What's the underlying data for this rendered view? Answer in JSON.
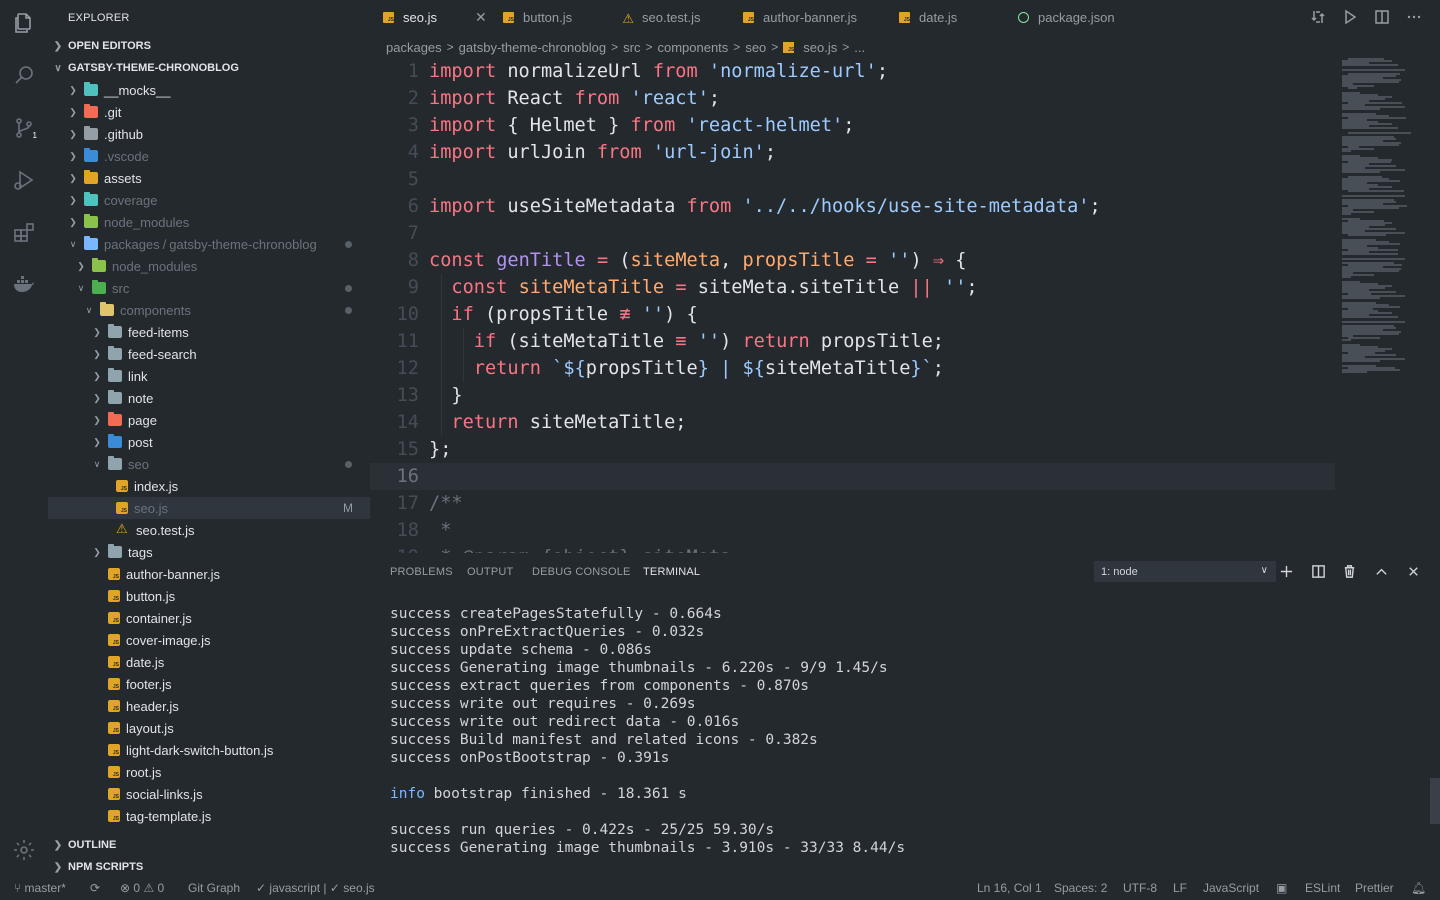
{
  "activity": {
    "icons": [
      "files-icon",
      "search-icon",
      "source-control-icon",
      "run-debug-icon",
      "extensions-icon",
      "docker-icon",
      "settings-gear-icon"
    ],
    "source_control_badge": "1"
  },
  "sidebar": {
    "title": "EXPLORER",
    "open_editors": "OPEN EDITORS",
    "project": "GATSBY-THEME-CHRONOBLOG",
    "tree": [
      {
        "label": "__mocks__",
        "dim": false
      },
      {
        "label": ".git",
        "dim": false
      },
      {
        "label": ".github",
        "dim": false
      },
      {
        "label": ".vscode",
        "dim": true
      },
      {
        "label": "assets",
        "dim": false
      },
      {
        "label": "coverage",
        "dim": true
      },
      {
        "label": "node_modules",
        "dim": true
      },
      {
        "label": "packages",
        "label2": "gatsby-theme-chronoblog",
        "sep": "/",
        "dim": true
      },
      {
        "label": "node_modules",
        "dim": true
      },
      {
        "label": "src",
        "dim": true
      },
      {
        "label": "components",
        "dim": true
      },
      {
        "label": "feed-items",
        "dim": false
      },
      {
        "label": "feed-search",
        "dim": false
      },
      {
        "label": "link",
        "dim": false
      },
      {
        "label": "note",
        "dim": false
      },
      {
        "label": "page",
        "dim": false
      },
      {
        "label": "post",
        "dim": false
      },
      {
        "label": "seo",
        "dim": true
      },
      {
        "label": "index.js",
        "dim": false
      },
      {
        "label": "seo.js",
        "dim": true,
        "badge": "M"
      },
      {
        "label": "seo.test.js",
        "dim": false
      },
      {
        "label": "tags",
        "dim": false
      },
      {
        "label": "author-banner.js",
        "dim": false
      },
      {
        "label": "button.js",
        "dim": false
      },
      {
        "label": "container.js",
        "dim": false
      },
      {
        "label": "cover-image.js",
        "dim": false
      },
      {
        "label": "date.js",
        "dim": false
      },
      {
        "label": "footer.js",
        "dim": false
      },
      {
        "label": "header.js",
        "dim": false
      },
      {
        "label": "layout.js",
        "dim": false
      },
      {
        "label": "light-dark-switch-button.js",
        "dim": false
      },
      {
        "label": "root.js",
        "dim": false
      },
      {
        "label": "social-links.js",
        "dim": false
      },
      {
        "label": "tag-template.js",
        "dim": false
      }
    ],
    "outline": "OUTLINE",
    "npm_scripts": "NPM SCRIPTS"
  },
  "tabs": [
    {
      "label": "seo.js",
      "active": true
    },
    {
      "label": "button.js"
    },
    {
      "label": "seo.test.js"
    },
    {
      "label": "author-banner.js"
    },
    {
      "label": "date.js"
    },
    {
      "label": "package.json"
    }
  ],
  "breadcrumb": [
    "packages",
    "gatsby-theme-chronoblog",
    "src",
    "components",
    "seo",
    "seo.js",
    "..."
  ],
  "editor": {
    "current_line": 16,
    "lines": [
      [
        [
          "k",
          "import"
        ],
        [
          "p",
          " normalizeUrl "
        ],
        [
          "k",
          "from"
        ],
        [
          "p",
          " "
        ],
        [
          "s",
          "'normalize-url'"
        ],
        [
          "p",
          ";"
        ]
      ],
      [
        [
          "k",
          "import"
        ],
        [
          "p",
          " React "
        ],
        [
          "k",
          "from"
        ],
        [
          "p",
          " "
        ],
        [
          "s",
          "'react'"
        ],
        [
          "p",
          ";"
        ]
      ],
      [
        [
          "k",
          "import"
        ],
        [
          "p",
          " { Helmet } "
        ],
        [
          "k",
          "from"
        ],
        [
          "p",
          " "
        ],
        [
          "s",
          "'react-helmet'"
        ],
        [
          "p",
          ";"
        ]
      ],
      [
        [
          "k",
          "import"
        ],
        [
          "p",
          " urlJoin "
        ],
        [
          "k",
          "from"
        ],
        [
          "p",
          " "
        ],
        [
          "s",
          "'url-join'"
        ],
        [
          "p",
          ";"
        ]
      ],
      [],
      [
        [
          "k",
          "import"
        ],
        [
          "p",
          " useSiteMetadata "
        ],
        [
          "k",
          "from"
        ],
        [
          "p",
          " "
        ],
        [
          "s",
          "'../../hooks/use-site-metadata'"
        ],
        [
          "p",
          ";"
        ]
      ],
      [],
      [
        [
          "k",
          "const"
        ],
        [
          "p",
          " "
        ],
        [
          "f",
          "genTitle"
        ],
        [
          "p",
          " "
        ],
        [
          "o",
          "="
        ],
        [
          "p",
          " ("
        ],
        [
          "v",
          "siteMeta"
        ],
        [
          "p",
          ", "
        ],
        [
          "v",
          "propsTitle"
        ],
        [
          "p",
          " "
        ],
        [
          "o",
          "="
        ],
        [
          "p",
          " "
        ],
        [
          "s",
          "''"
        ],
        [
          "p",
          ") "
        ],
        [
          "o",
          "⇒"
        ],
        [
          "p",
          " {"
        ]
      ],
      [
        [
          "p",
          "  "
        ],
        [
          "k",
          "const"
        ],
        [
          "p",
          " "
        ],
        [
          "v",
          "siteMetaTitle"
        ],
        [
          "p",
          " "
        ],
        [
          "o",
          "="
        ],
        [
          "p",
          " siteMeta.siteTitle "
        ],
        [
          "o",
          "||"
        ],
        [
          "p",
          " "
        ],
        [
          "s",
          "''"
        ],
        [
          "p",
          ";"
        ]
      ],
      [
        [
          "p",
          "  "
        ],
        [
          "k",
          "if"
        ],
        [
          "p",
          " (propsTitle "
        ],
        [
          "o",
          "≢"
        ],
        [
          "p",
          " "
        ],
        [
          "s",
          "''"
        ],
        [
          "p",
          ") {"
        ]
      ],
      [
        [
          "p",
          "    "
        ],
        [
          "k",
          "if"
        ],
        [
          "p",
          " (siteMetaTitle "
        ],
        [
          "o",
          "≡"
        ],
        [
          "p",
          " "
        ],
        [
          "s",
          "''"
        ],
        [
          "p",
          ") "
        ],
        [
          "k",
          "return"
        ],
        [
          "p",
          " propsTitle;"
        ]
      ],
      [
        [
          "p",
          "    "
        ],
        [
          "k",
          "return"
        ],
        [
          "p",
          " "
        ],
        [
          "s",
          "`${"
        ],
        [
          "p",
          "propsTitle"
        ],
        [
          "s",
          "} | ${"
        ],
        [
          "p",
          "siteMetaTitle"
        ],
        [
          "s",
          "}`"
        ],
        [
          "p",
          ";"
        ]
      ],
      [
        [
          "p",
          "  }"
        ]
      ],
      [
        [
          "p",
          "  "
        ],
        [
          "k",
          "return"
        ],
        [
          "p",
          " siteMetaTitle;"
        ]
      ],
      [
        [
          "p",
          "};"
        ]
      ],
      [],
      [
        [
          "c",
          "/**"
        ]
      ],
      [
        [
          "c",
          " *"
        ]
      ],
      [
        [
          "c",
          " * @param {object} siteMeta"
        ]
      ]
    ]
  },
  "panel": {
    "tabs": [
      "PROBLEMS",
      "OUTPUT",
      "DEBUG CONSOLE",
      "TERMINAL"
    ],
    "active_tab": "TERMINAL",
    "terminal_select": "1: node",
    "lines": [
      {
        "level": "success",
        "text": " createPagesStatefully - 0.664s"
      },
      {
        "level": "success",
        "text": " onPreExtractQueries - 0.032s"
      },
      {
        "level": "success",
        "text": " update schema - 0.086s"
      },
      {
        "level": "success",
        "text": " Generating image thumbnails - 6.220s - 9/9 1.45/s"
      },
      {
        "level": "success",
        "text": " extract queries from components - 0.870s"
      },
      {
        "level": "success",
        "text": " write out requires - 0.269s"
      },
      {
        "level": "success",
        "text": " write out redirect data - 0.016s"
      },
      {
        "level": "success",
        "text": " Build manifest and related icons - 0.382s"
      },
      {
        "level": "success",
        "text": " onPostBootstrap - 0.391s"
      },
      {
        "level": "",
        "text": ""
      },
      {
        "level": "info",
        "text": " bootstrap finished - 18.361 s"
      },
      {
        "level": "",
        "text": ""
      },
      {
        "level": "success",
        "text": " run queries - 0.422s - 25/25 59.30/s"
      },
      {
        "level": "success",
        "text": " Generating image thumbnails - 3.910s - 33/33 8.44/s"
      }
    ]
  },
  "status": {
    "branch": "master*",
    "problems": "0",
    "warnings": "0",
    "git_graph": "Git Graph",
    "lang_check": "javascript | ",
    "file_check": "seo.js",
    "position": "Ln 16, Col 1",
    "spaces": "Spaces: 2",
    "encoding": "UTF-8",
    "eol": "LF",
    "language": "JavaScript",
    "eslint": "ESLint",
    "prettier": "Prettier"
  }
}
